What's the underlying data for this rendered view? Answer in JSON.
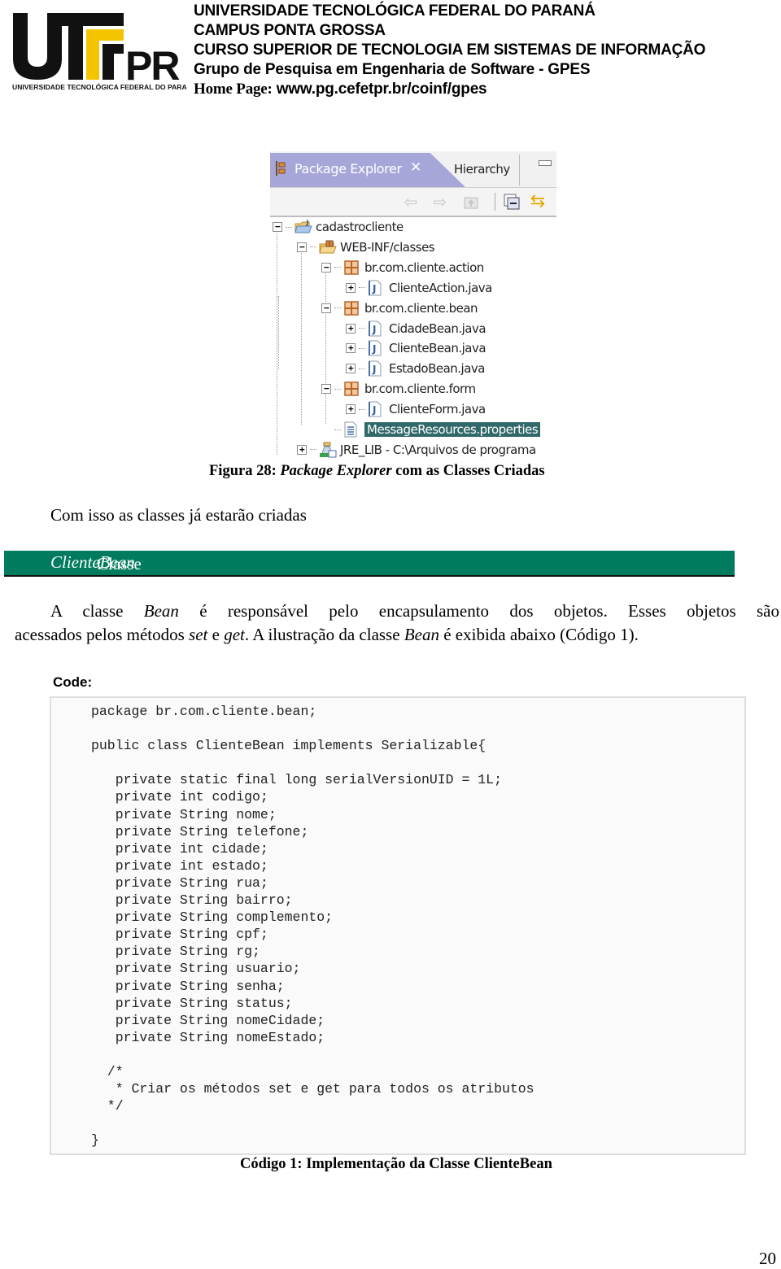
{
  "header": {
    "logo": {
      "text": "UTFPR",
      "subtitle": "UNIVERSIDADE TECNOLÓGICA FEDERAL DO PARANÁ",
      "accent_color": "#f5c400"
    },
    "lines": [
      "UNIVERSIDADE TECNOLÓGICA FEDERAL DO PARANÁ",
      "CAMPUS PONTA GROSSA",
      "CURSO SUPERIOR DE TECNOLOGIA EM SISTEMAS DE INFORMAÇÃO",
      "Grupo de Pesquisa em Engenharia de Software - GPES"
    ],
    "homepage_label": "Home Page:",
    "homepage_url": "www.pg.cefetpr.br/coinf/gpes"
  },
  "package_explorer": {
    "active_tab": "Package Explorer",
    "close_icon": "close-icon",
    "other_tab": "Hierarchy",
    "toolbar": [
      "back-arrow-icon",
      "forward-arrow-icon",
      "up-folder-icon",
      "collapse-all-icon",
      "link-with-editor-icon"
    ],
    "tree": [
      {
        "label": "cadastrocliente",
        "icon": "project-folder-icon",
        "toggle": "−",
        "depth": 0
      },
      {
        "label": "WEB-INF/classes",
        "icon": "source-folder-icon",
        "toggle": "−",
        "depth": 1
      },
      {
        "label": "br.com.cliente.action",
        "icon": "package-icon",
        "toggle": "−",
        "depth": 2
      },
      {
        "label": "ClienteAction.java",
        "icon": "java-file-icon",
        "toggle": "+",
        "depth": 3
      },
      {
        "label": "br.com.cliente.bean",
        "icon": "package-icon",
        "toggle": "−",
        "depth": 2
      },
      {
        "label": "CidadeBean.java",
        "icon": "java-file-icon",
        "toggle": "+",
        "depth": 3
      },
      {
        "label": "ClienteBean.java",
        "icon": "java-file-icon",
        "toggle": "+",
        "depth": 3
      },
      {
        "label": "EstadoBean.java",
        "icon": "java-file-icon",
        "toggle": "+",
        "depth": 3
      },
      {
        "label": "br.com.cliente.form",
        "icon": "package-icon",
        "toggle": "−",
        "depth": 2
      },
      {
        "label": "ClienteForm.java",
        "icon": "java-file-icon",
        "toggle": "+",
        "depth": 3
      },
      {
        "label": "MessageResources.properties",
        "icon": "properties-file-icon",
        "toggle": "",
        "depth": 2,
        "selected": true
      },
      {
        "label": "JRE_LIB - C:\\Arquivos de programa",
        "icon": "library-icon",
        "toggle": "+",
        "depth": 1
      }
    ],
    "selection_color": "#31686a",
    "tab_color": "#a6a6d8"
  },
  "figure_caption": {
    "prefix": "Figura 28: ",
    "italic": "Package Explorer",
    "suffix": " com as Classes Criadas"
  },
  "intro_text": "Com isso as classes já estarão criadas",
  "section_bar": {
    "prefix": "Classe ",
    "italic": "ClienteBean",
    "suffix": ":",
    "color": "#007b5e"
  },
  "paragraph": {
    "line1": [
      {
        "t": "A classe ",
        "i": false
      },
      {
        "t": "Bean",
        "i": true
      },
      {
        "t": " é responsável pelo encapsulamento dos objetos. Esses objetos são",
        "i": false
      }
    ],
    "line2": [
      {
        "t": "acessados pelos métodos ",
        "i": false
      },
      {
        "t": "set",
        "i": true
      },
      {
        "t": " e ",
        "i": false
      },
      {
        "t": "get",
        "i": true
      },
      {
        "t": ". A ilustração da classe ",
        "i": false
      },
      {
        "t": "Bean",
        "i": true
      },
      {
        "t": " é exibida abaixo (Código 1).",
        "i": false
      }
    ]
  },
  "code_label": "Code:",
  "code_lines": [
    "package br.com.cliente.bean;",
    "",
    "public class ClienteBean implements Serializable{",
    "",
    "   private static final long serialVersionUID = 1L;",
    "   private int codigo;",
    "   private String nome;",
    "   private String telefone;",
    "   private int cidade;",
    "   private int estado;",
    "   private String rua;",
    "   private String bairro;",
    "   private String complemento;",
    "   private String cpf;",
    "   private String rg;",
    "   private String usuario;",
    "   private String senha;",
    "   private String status;",
    "   private String nomeCidade;",
    "   private String nomeEstado;",
    "",
    "  /*",
    "   * Criar os métodos set e get para todos os atributos",
    "  */",
    "",
    "}"
  ],
  "code_caption": "Código 1: Implementação da Classe ClienteBean",
  "page_number": "20"
}
